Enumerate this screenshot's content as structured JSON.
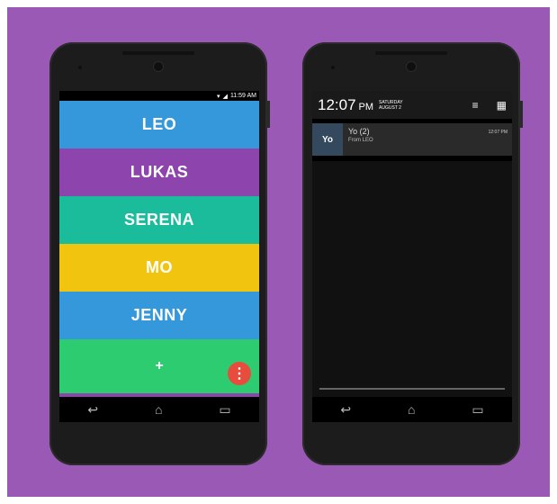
{
  "colors": {
    "background": "#9b59b6",
    "leo": "#3498db",
    "lukas": "#8e44ad",
    "serena": "#1abc9c",
    "mo": "#f1c40f",
    "jenny": "#3498db",
    "add": "#2ecc71",
    "fab": "#e74c3c",
    "yo_tile": "#34495e"
  },
  "left_phone": {
    "status_time": "11:59 AM",
    "contacts": [
      {
        "name": "LEO"
      },
      {
        "name": "LUKAS"
      },
      {
        "name": "SERENA"
      },
      {
        "name": "MO"
      },
      {
        "name": "JENNY"
      }
    ],
    "add_label": "+",
    "menu_label": "⋮"
  },
  "right_phone": {
    "time": "12:07",
    "ampm": "PM",
    "day": "SATURDAY",
    "date": "AUGUST 2",
    "notification": {
      "icon_label": "Yo",
      "title": "Yo (2)",
      "subtitle": "From LEO",
      "time": "12:07 PM"
    }
  },
  "nav": {
    "back": "↩",
    "home": "⌂",
    "recents": "▭"
  }
}
